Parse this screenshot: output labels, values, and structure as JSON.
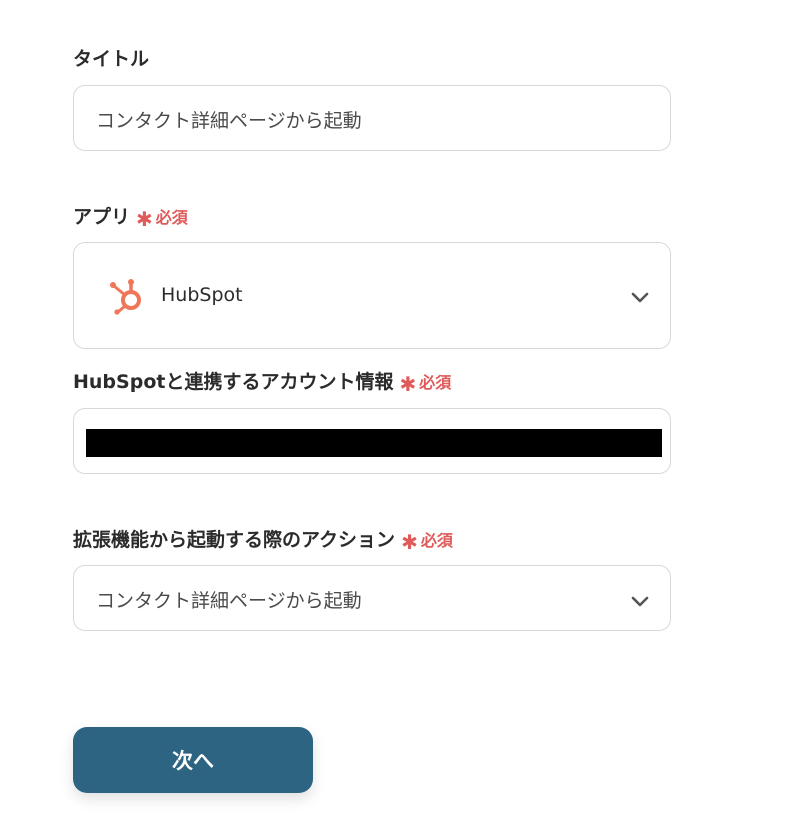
{
  "title_field": {
    "label": "タイトル",
    "value": "コンタクト詳細ページから起動"
  },
  "app_field": {
    "label": "アプリ",
    "required_label": "必須",
    "selected_app": "HubSpot",
    "app_icon": "hubspot-icon",
    "chevron": "chevron-down-icon"
  },
  "account_field": {
    "label": "HubSpotと連携するアカウント情報",
    "required_label": "必須"
  },
  "action_field": {
    "label": "拡張機能から起動する際のアクション",
    "required_label": "必須",
    "selected_value": "コンタクト詳細ページから起動",
    "chevron": "chevron-down-icon"
  },
  "next_button": {
    "label": "次へ"
  },
  "colors": {
    "primary": "#2d6482",
    "required": "#e05a5a",
    "hubspot_orange": "#f0765a",
    "border": "#d8d8d8"
  }
}
